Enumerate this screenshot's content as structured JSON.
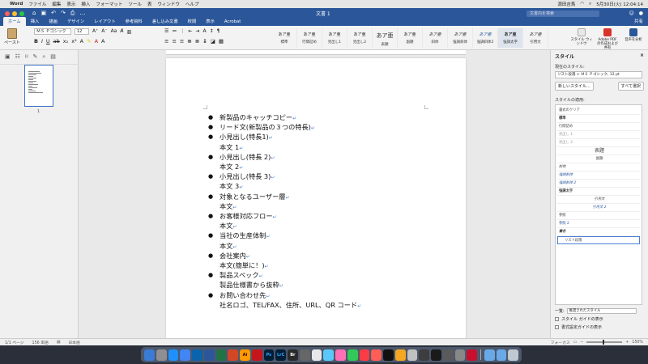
{
  "mac_menubar": {
    "app": "Word",
    "menus": [
      "ファイル",
      "編集",
      "表示",
      "挿入",
      "フォーマット",
      "ツール",
      "表",
      "ウィンドウ",
      "ヘルプ"
    ],
    "user": "源田吉馬",
    "datetime": "5月30日(火) 12:04:14"
  },
  "titlebar": {
    "doc_title": "文書 1",
    "search_placeholder": "文書内を検索"
  },
  "ribbon_tabs": {
    "tabs": [
      "ホーム",
      "挿入",
      "描画",
      "デザイン",
      "レイアウト",
      "参考資料",
      "差し込み文書",
      "校閲",
      "表示",
      "Acrobat"
    ],
    "share": "共有"
  },
  "ribbon": {
    "paste_label": "ペースト",
    "font_name": "ＭＳ Ｐゴシック",
    "font_size": "12",
    "style_tiles": [
      {
        "sample": "あア亜",
        "name": "標準"
      },
      {
        "sample": "あア亜",
        "name": "行間詰め"
      },
      {
        "sample": "あア亜",
        "name": "見出し1"
      },
      {
        "sample": "あア亜",
        "name": "見出し2"
      },
      {
        "sample": "あア亜",
        "name": "表題"
      },
      {
        "sample": "あア亜",
        "name": "副題"
      },
      {
        "sample": "あア亜",
        "name": "斜体"
      },
      {
        "sample": "あア亜",
        "name": "強調斜体"
      },
      {
        "sample": "あア亜",
        "name": "強調斜体2"
      },
      {
        "sample": "あア亜",
        "name": "強調太字"
      },
      {
        "sample": "あア亜",
        "name": "引用文"
      }
    ],
    "styles_pane_label": "スタイル ウィンドウ",
    "acrobat_label": "Adobe PDF の作成および共有",
    "dictate_label": "音声を分析"
  },
  "thumbnail": {
    "page_num": "1"
  },
  "document": {
    "lines": [
      {
        "text": "新製品のキャッチコピー",
        "bullet": true
      },
      {
        "text": "リード文(新製品の３つの特長)",
        "bullet": true
      },
      {
        "text": "小見出し(特長1)",
        "bullet": true
      },
      {
        "text": "本文 1",
        "bullet": false
      },
      {
        "text": "小見出し(特長 2)",
        "bullet": true
      },
      {
        "text": "本文 2",
        "bullet": false
      },
      {
        "text": "小見出し(特長 3)",
        "bullet": true
      },
      {
        "text": "本文 3",
        "bullet": false
      },
      {
        "text": "対象となるユーザー層",
        "bullet": true
      },
      {
        "text": "本文",
        "bullet": false
      },
      {
        "text": "お客様対応フロー",
        "bullet": true
      },
      {
        "text": "本文",
        "bullet": false
      },
      {
        "text": "当社の生産体制",
        "bullet": true
      },
      {
        "text": "本文",
        "bullet": false
      },
      {
        "text": "会社案内",
        "bullet": true
      },
      {
        "text": "本文(簡単に！)",
        "bullet": false
      },
      {
        "text": "製品スペック",
        "bullet": true
      },
      {
        "text": "製品仕様書から抜粋",
        "bullet": false
      },
      {
        "text": "お問い合わせ先",
        "bullet": true
      },
      {
        "text": "社名ロゴ、TEL/FAX、住所、URL、QR コード",
        "bullet": false
      }
    ]
  },
  "styles_pane": {
    "title": "スタイル",
    "current_label": "現在のスタイル:",
    "current_value": "リスト段落 + ＭＳ Ｐゴシック, 12 pt",
    "new_style": "新しいスタイル...",
    "select_all": "すべて選択",
    "apply_label": "スタイルの適用:",
    "styles": [
      "書式のクリア",
      "標準",
      "行間詰め",
      "見出し 1",
      "見出し 2",
      "表題",
      "副題",
      "斜体",
      "強調斜体",
      "強調斜体 2",
      "強調太字",
      "引用文",
      "引用文 2",
      "参照",
      "参照 2",
      "書名",
      "リスト段落"
    ],
    "list_label": "一覧:",
    "list_value": "推奨されたスタイル",
    "guide1": "スタイル ガイドの表示",
    "guide2": "書式設定ガイドの表示"
  },
  "statusbar": {
    "page": "1/1 ページ",
    "words": "156 単語",
    "lang": "日本語",
    "focus": "フォーカス",
    "zoom": "150%"
  }
}
